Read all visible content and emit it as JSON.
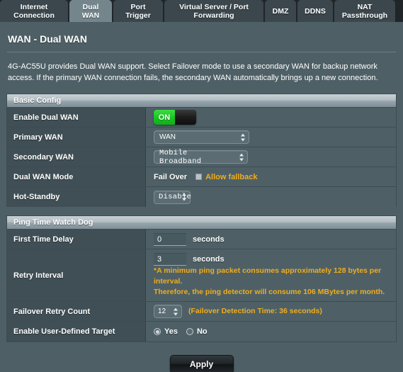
{
  "tabs": [
    {
      "id": "internet-connection",
      "line1": "Internet",
      "line2": "Connection",
      "active": false
    },
    {
      "id": "dual-wan",
      "line1": "Dual",
      "line2": "WAN",
      "active": true
    },
    {
      "id": "port-trigger",
      "line1": "Port",
      "line2": "Trigger",
      "active": false
    },
    {
      "id": "virtual-server-port-forwarding",
      "line1": "Virtual Server / Port",
      "line2": "Forwarding",
      "active": false
    },
    {
      "id": "dmz",
      "line1": "DMZ",
      "line2": "",
      "active": false
    },
    {
      "id": "ddns",
      "line1": "DDNS",
      "line2": "",
      "active": false
    },
    {
      "id": "nat-passthrough",
      "line1": "NAT",
      "line2": "Passthrough",
      "active": false
    }
  ],
  "page": {
    "title": "WAN - Dual WAN",
    "description": "4G-AC55U provides Dual WAN support. Select Failover mode to use a secondary WAN for backup network access. If the primary WAN connection fails, the secondary WAN automatically brings up a new connection."
  },
  "basic_config": {
    "heading": "Basic Config",
    "enable_dual_wan": {
      "label": "Enable Dual WAN",
      "state": "ON"
    },
    "primary_wan": {
      "label": "Primary WAN",
      "value": "WAN"
    },
    "secondary_wan": {
      "label": "Secondary WAN",
      "value": "Mobile Broadband"
    },
    "dual_wan_mode": {
      "label": "Dual WAN Mode",
      "value": "Fail Over",
      "allow_fallback_label": "Allow fallback",
      "allow_fallback_checked": false
    },
    "hot_standby": {
      "label": "Hot-Standby",
      "value": "Disable"
    }
  },
  "ping_watch_dog": {
    "heading": "Ping Time Watch Dog",
    "first_time_delay": {
      "label": "First Time Delay",
      "value": "0",
      "unit": "seconds"
    },
    "retry_interval": {
      "label": "Retry Interval",
      "value": "3",
      "unit": "seconds",
      "note_line1": "*A minimum ping packet consumes approximately 128 bytes per interval.",
      "note_line2": "Therefore, the ping detector will consume 106 MBytes per month."
    },
    "failover_retry_count": {
      "label": "Failover Retry Count",
      "value": "12",
      "detection_note": "(Failover Detection Time: 36  seconds)"
    },
    "user_defined_target": {
      "label": "Enable User-Defined Target",
      "yes_label": "Yes",
      "no_label": "No",
      "selected": "Yes"
    }
  },
  "footer": {
    "apply_label": "Apply"
  },
  "colors": {
    "accent_orange": "#f0ad1e",
    "toggle_green": "#19c322",
    "panel_bg": "#4e6066",
    "label_bg": "#3f4f55"
  }
}
